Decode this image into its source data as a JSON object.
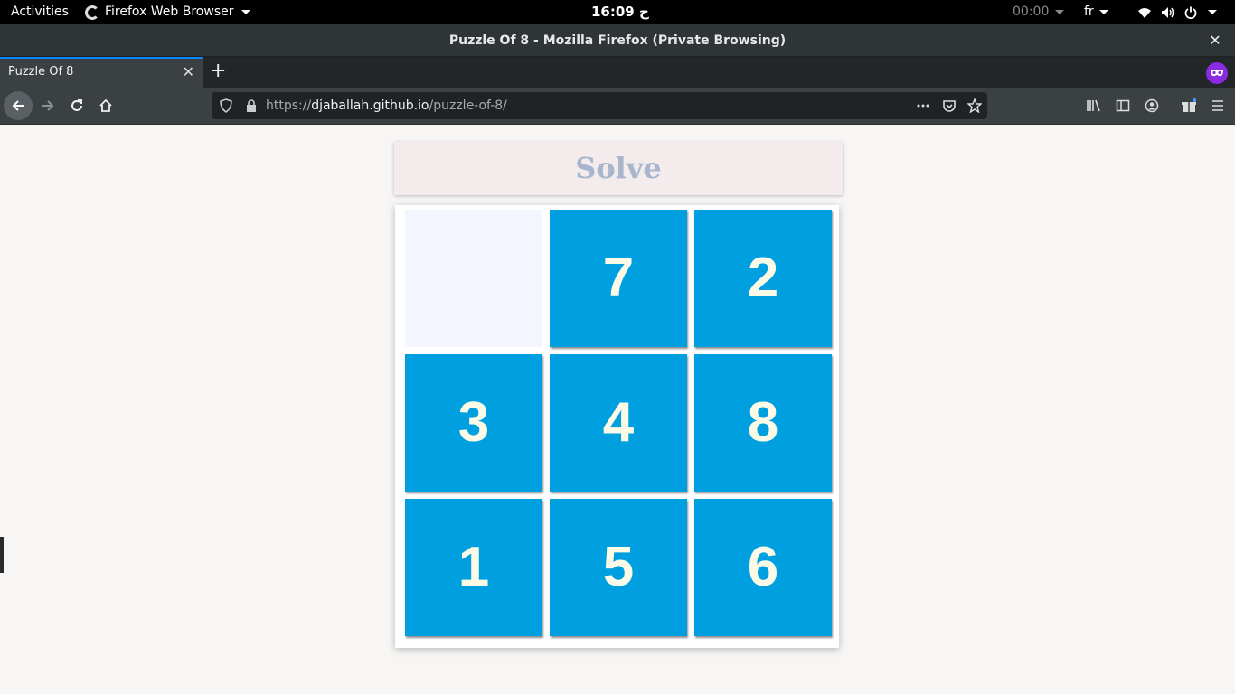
{
  "topbar": {
    "activities": "Activities",
    "app_menu": "Firefox Web Browser",
    "clock": "ح 16:09",
    "timer": "00:00",
    "lang": "fr"
  },
  "window": {
    "title": "Puzzle Of 8 - Mozilla Firefox (Private Browsing)",
    "close": "✕"
  },
  "tab": {
    "title": "Puzzle Of 8",
    "close": "✕",
    "new_tab": "+"
  },
  "urlbar": {
    "prefix": "https://",
    "domain": "djaballah.github.io",
    "path": "/puzzle-of-8/"
  },
  "page": {
    "solve_label": "Solve",
    "tiles": [
      "",
      "7",
      "2",
      "3",
      "4",
      "8",
      "1",
      "5",
      "6"
    ]
  },
  "colors": {
    "tile": "#009fe0",
    "tile_text": "#fafae6",
    "empty_tile": "#f3f6fe",
    "solve_text": "#a7b6cc",
    "private_badge": "#8a2be2"
  }
}
